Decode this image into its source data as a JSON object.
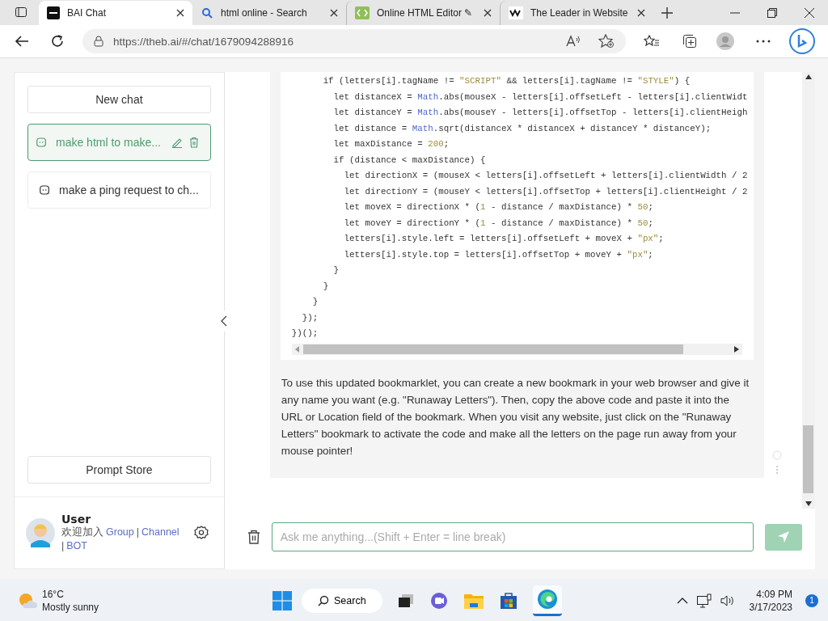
{
  "browser": {
    "tabs": [
      {
        "title": "BAI Chat",
        "kind": "bai",
        "selected": true
      },
      {
        "title": "html online - Search",
        "kind": "search",
        "selected": false
      },
      {
        "title": "Online HTML Editor ✎",
        "kind": "code",
        "selected": false
      },
      {
        "title": "The Leader in Website",
        "kind": "wix",
        "selected": false
      }
    ],
    "url": "https://theb.ai/#/chat/1679094288916"
  },
  "sidebar": {
    "new_chat": "New chat",
    "chats": [
      {
        "title": "make html to make...",
        "selected": true
      },
      {
        "title": "make a ping request to ch...",
        "selected": false
      }
    ],
    "prompt_store": "Prompt Store",
    "user": {
      "name": "User",
      "welcome": "欢迎加入",
      "links": [
        "Group",
        "Channel",
        "BOT"
      ],
      "separators": [
        "|",
        "|"
      ]
    }
  },
  "code_lines": [
    [
      {
        "t": "      if (letters[i].tagName != ",
        "kind": "plain"
      },
      {
        "t": "\"SCRIPT\"",
        "kind": "str"
      },
      {
        "t": " && letters[i].tagName != ",
        "kind": "plain"
      },
      {
        "t": "\"STYLE\"",
        "kind": "str"
      },
      {
        "t": ") {",
        "kind": "plain"
      }
    ],
    [
      {
        "t": "        let distanceX = ",
        "kind": "plain"
      },
      {
        "t": "Math",
        "kind": "obj"
      },
      {
        "t": ".abs(mouseX - letters[i].offsetLeft - letters[i].clientWidt",
        "kind": "plain"
      }
    ],
    [
      {
        "t": "        let distanceY = ",
        "kind": "plain"
      },
      {
        "t": "Math",
        "kind": "obj"
      },
      {
        "t": ".abs(mouseY - letters[i].offsetTop - letters[i].clientHeigh",
        "kind": "plain"
      }
    ],
    [
      {
        "t": "        let distance = ",
        "kind": "plain"
      },
      {
        "t": "Math",
        "kind": "obj"
      },
      {
        "t": ".sqrt(distanceX * distanceX + distanceY * distanceY);",
        "kind": "plain"
      }
    ],
    [
      {
        "t": "        let maxDistance = ",
        "kind": "plain"
      },
      {
        "t": "200",
        "kind": "num"
      },
      {
        "t": ";",
        "kind": "plain"
      }
    ],
    [
      {
        "t": "        if (distance < maxDistance) {",
        "kind": "plain"
      }
    ],
    [
      {
        "t": "          let directionX = (mouseX < letters[i].offsetLeft + letters[i].clientWidth / 2",
        "kind": "plain"
      }
    ],
    [
      {
        "t": "          let directionY = (mouseY < letters[i].offsetTop + letters[i].clientHeight / 2",
        "kind": "plain"
      }
    ],
    [
      {
        "t": "          let moveX = directionX * (",
        "kind": "plain"
      },
      {
        "t": "1",
        "kind": "num"
      },
      {
        "t": " - distance / maxDistance) * ",
        "kind": "plain"
      },
      {
        "t": "50",
        "kind": "num"
      },
      {
        "t": ";",
        "kind": "plain"
      }
    ],
    [
      {
        "t": "          let moveY = directionY * (",
        "kind": "plain"
      },
      {
        "t": "1",
        "kind": "num"
      },
      {
        "t": " - distance / maxDistance) * ",
        "kind": "plain"
      },
      {
        "t": "50",
        "kind": "num"
      },
      {
        "t": ";",
        "kind": "plain"
      }
    ],
    [
      {
        "t": "          letters[i].style.left = letters[i].offsetLeft + moveX + ",
        "kind": "plain"
      },
      {
        "t": "\"px\"",
        "kind": "str"
      },
      {
        "t": ";",
        "kind": "plain"
      }
    ],
    [
      {
        "t": "          letters[i].style.top = letters[i].offsetTop + moveY + ",
        "kind": "plain"
      },
      {
        "t": "\"px\"",
        "kind": "str"
      },
      {
        "t": ";",
        "kind": "plain"
      }
    ],
    [
      {
        "t": "        }",
        "kind": "plain"
      }
    ],
    [
      {
        "t": "      }",
        "kind": "plain"
      }
    ],
    [
      {
        "t": "    }",
        "kind": "plain"
      }
    ],
    [
      {
        "t": "  });",
        "kind": "plain"
      }
    ],
    [
      {
        "t": "})();",
        "kind": "plain"
      }
    ]
  ],
  "answer": "To use this updated bookmarklet, you can create a new bookmark in your web browser and give it any name you want (e.g. \"Runaway Letters\"). Then, copy the above code and paste it into the URL or Location field of the bookmark. When you visit any website, just click on the \"Runaway Letters\" bookmark to activate the code and make all the letters on the page run away from your mouse pointer!",
  "input": {
    "placeholder": "Ask me anything...(Shift + Enter = line break)"
  },
  "taskbar": {
    "weather": {
      "temp": "16°C",
      "condition": "Mostly sunny"
    },
    "search": "Search",
    "time": "4:09 PM",
    "date": "3/17/2023",
    "notifications": "1"
  }
}
